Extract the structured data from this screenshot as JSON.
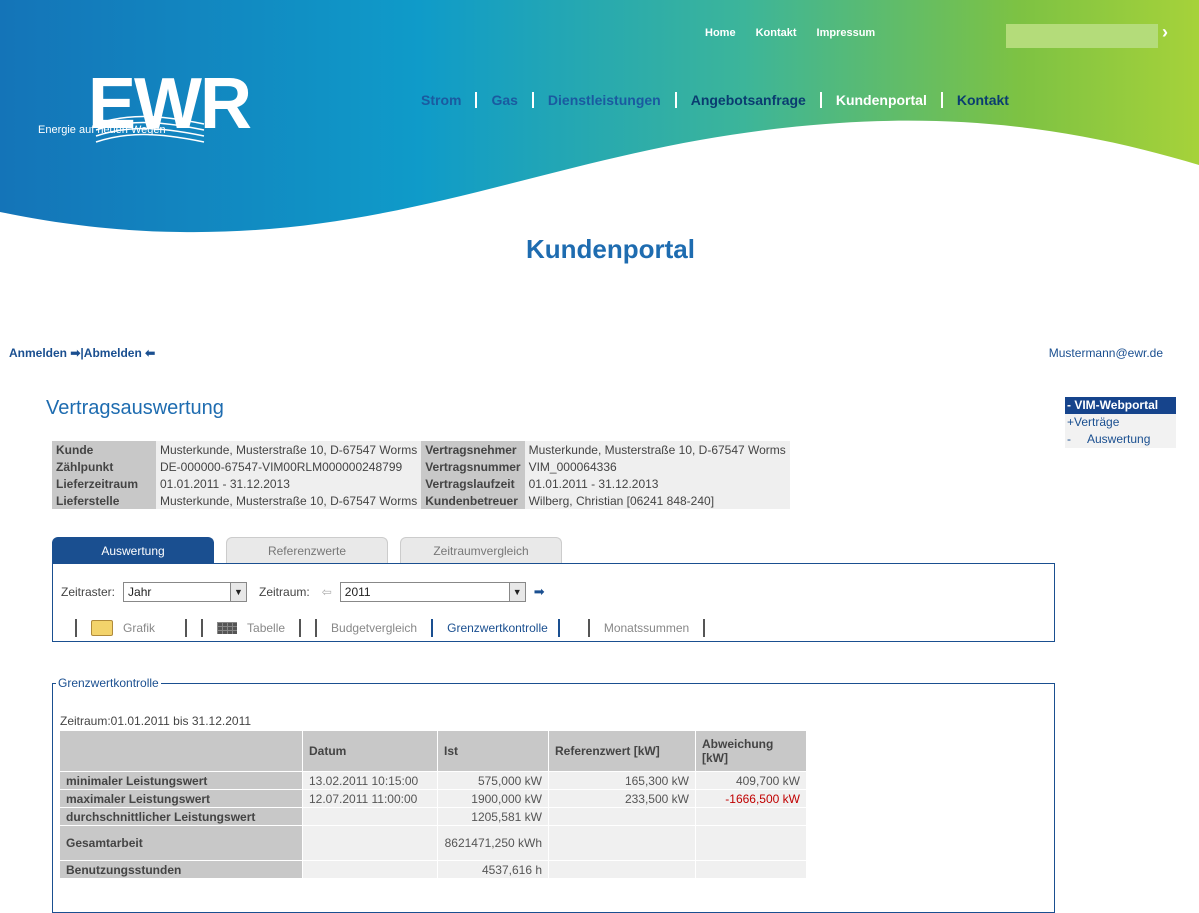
{
  "brand": {
    "logo_text": "EWR",
    "tagline": "Energie auf neuen Wegen"
  },
  "topnav": [
    "Home",
    "Kontakt",
    "Impressum"
  ],
  "search": {
    "go_icon": "chevron-right-icon",
    "placeholder": ""
  },
  "mainnav": [
    "Strom",
    "Gas",
    "Dienstleistungen",
    "Angebotsanfrage",
    "Kundenportal",
    "Kontakt"
  ],
  "page_heading": "Kundenportal",
  "auth": {
    "login": "Anmelden",
    "separator": "|",
    "logout": "Abmelden"
  },
  "user_email": "Mustermann@ewr.de",
  "sidebar": {
    "head": "- VIM-Webportal",
    "items": [
      "+Verträge",
      "-     Auswertung"
    ]
  },
  "title": "Vertragsauswertung",
  "contract": {
    "kunde_label": "Kunde",
    "kunde": "Musterkunde, Musterstraße 10, D-67547 Worms",
    "vertragsnehmer_label": "Vertragsnehmer",
    "vertragsnehmer": "Musterkunde, Musterstraße 10, D-67547 Worms",
    "zaehlpunkt_label": "Zählpunkt",
    "zaehlpunkt": "DE-000000-67547-VIM00RLM000000248799",
    "vertragsnummer_label": "Vertragsnummer",
    "vertragsnummer": "VIM_000064336",
    "lieferzeitraum_label": "Lieferzeitraum",
    "lieferzeitraum": "01.01.2011 - 31.12.2013",
    "vertragslaufzeit_label": "Vertragslaufzeit",
    "vertragslaufzeit": "01.01.2011 - 31.12.2013",
    "lieferstelle_label": "Lieferstelle",
    "lieferstelle": "Musterkunde, Musterstraße 10, D-67547 Worms",
    "kundenbetreuer_label": "Kundenbetreuer",
    "kundenbetreuer": "Wilberg, Christian [06241 848-240]"
  },
  "tabs": [
    "Auswertung",
    "Referenzwerte",
    "Zeitraumvergleich"
  ],
  "filters": {
    "zeitraster_label": "Zeitraster:",
    "zeitraster_value": "Jahr",
    "zeitraum_label": "Zeitraum:",
    "zeitraum_value": "2011"
  },
  "views": {
    "grafik": "Grafik",
    "tabelle": "Tabelle",
    "budget": "Budgetvergleich",
    "grenzwert": "Grenzwertkontrolle",
    "monats": "Monatssummen"
  },
  "result": {
    "legend": "Grenzwertkontrolle",
    "range": "Zeitraum:01.01.2011 bis 31.12.2011",
    "columns": [
      "",
      "Datum",
      "Ist",
      "Referenzwert [kW]",
      "Abweichung [kW]"
    ],
    "rows": [
      {
        "label": "minimaler Leistungswert",
        "datum": "13.02.2011 10:15:00",
        "ist": "575,000 kW",
        "ref": "165,300 kW",
        "abw": "409,700 kW"
      },
      {
        "label": "maximaler Leistungswert",
        "datum": "12.07.2011 11:00:00",
        "ist": "1900,000 kW",
        "ref": "233,500 kW",
        "abw": "-1666,500 kW"
      },
      {
        "label": "durchschnittlicher Leistungswert",
        "datum": "",
        "ist": "1205,581 kW",
        "ref": "",
        "abw": ""
      },
      {
        "label": "Gesamtarbeit",
        "datum": "",
        "ist": "8621471,250 kWh",
        "ref": "",
        "abw": ""
      },
      {
        "label": "Benutzungsstunden",
        "datum": "",
        "ist": "4537,616 h",
        "ref": "",
        "abw": ""
      }
    ],
    "negative_color": "#c00000"
  },
  "colors": {
    "brand_blue": "#1a4f90",
    "header_green": "#8cc63f",
    "header_teal": "#1aa0c8"
  }
}
